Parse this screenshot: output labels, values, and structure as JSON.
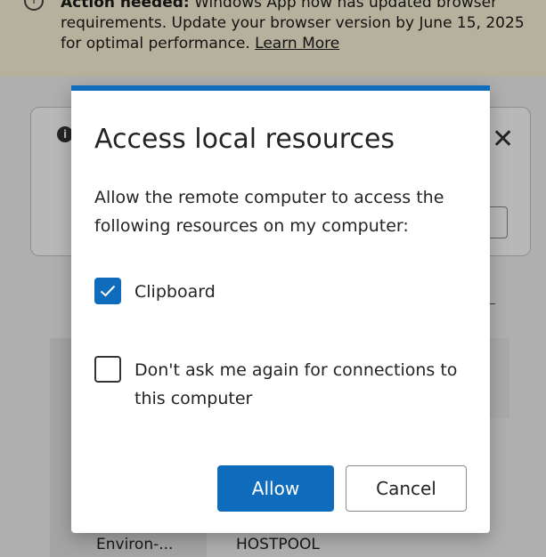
{
  "banner": {
    "icon": "info-circle-icon",
    "bold_text": "Action needed:",
    "text": " Windows App now has updated browser requirements. Update your browser version by June 15, 2025 for optimal performance. ",
    "link": "Learn More"
  },
  "background": {
    "labels": [
      "Environ-...",
      "HOSTPOOL"
    ]
  },
  "dialog": {
    "title": "Access local resources",
    "description": "Allow the remote computer to access the following resources on my computer:",
    "options": [
      {
        "label": "Clipboard",
        "checked": true
      },
      {
        "label": "Don't ask me again for connections to this computer",
        "checked": false
      }
    ],
    "allow_label": "Allow",
    "cancel_label": "Cancel"
  },
  "colors": {
    "accent": "#0f6cbd",
    "banner_bg": "#fdf6d8"
  }
}
